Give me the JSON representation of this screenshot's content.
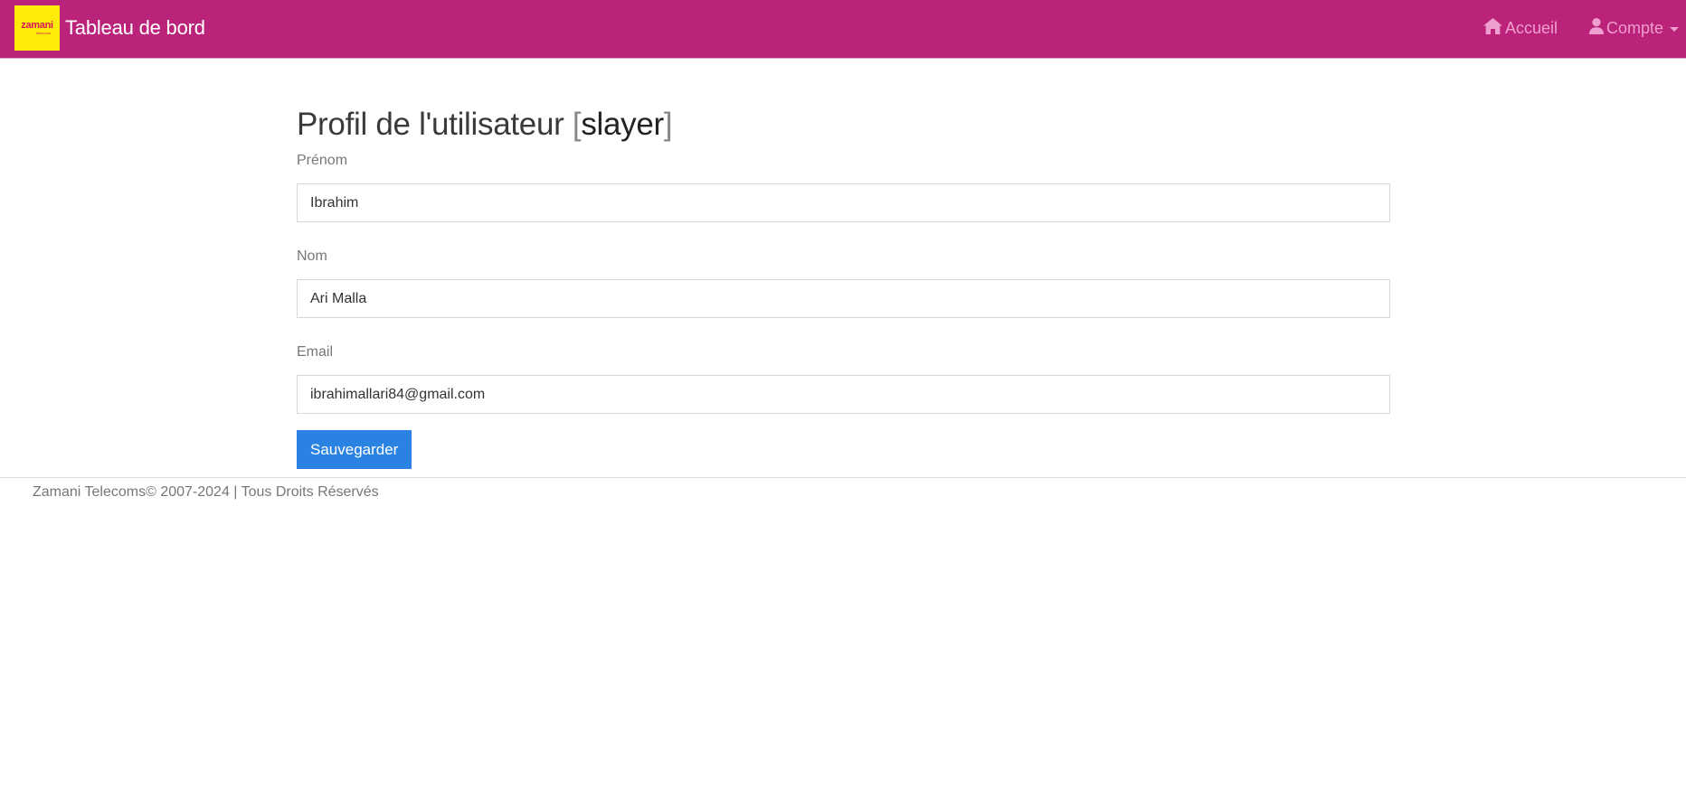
{
  "colors": {
    "navbar_bg": "#bb237a",
    "nav_link": "#ee9fcd",
    "logo_bg": "#ffeb0a",
    "logo_text": "#d4145a",
    "button_bg": "#2a83e3",
    "label_text": "#777777"
  },
  "navbar": {
    "logo": {
      "text": "zamani",
      "subtext": "telecoms"
    },
    "title": "Tableau de bord",
    "home_icon": "home-icon",
    "home_label": "Accueil",
    "account_icon": "user-icon",
    "account_label": "Compte"
  },
  "page": {
    "title_prefix": "Profil de l'utilisateur ",
    "bracket_open": "[",
    "username": "slayer",
    "bracket_close": "]"
  },
  "form": {
    "first_name": {
      "label": "Prénom",
      "value": "Ibrahim"
    },
    "last_name": {
      "label": "Nom",
      "value": "Ari Malla"
    },
    "email": {
      "label": "Email",
      "value": "ibrahimallari84@gmail.com"
    },
    "save_label": "Sauvegarder"
  },
  "footer": {
    "text": "Zamani Telecoms© 2007-2024 | Tous Droits Réservés"
  }
}
